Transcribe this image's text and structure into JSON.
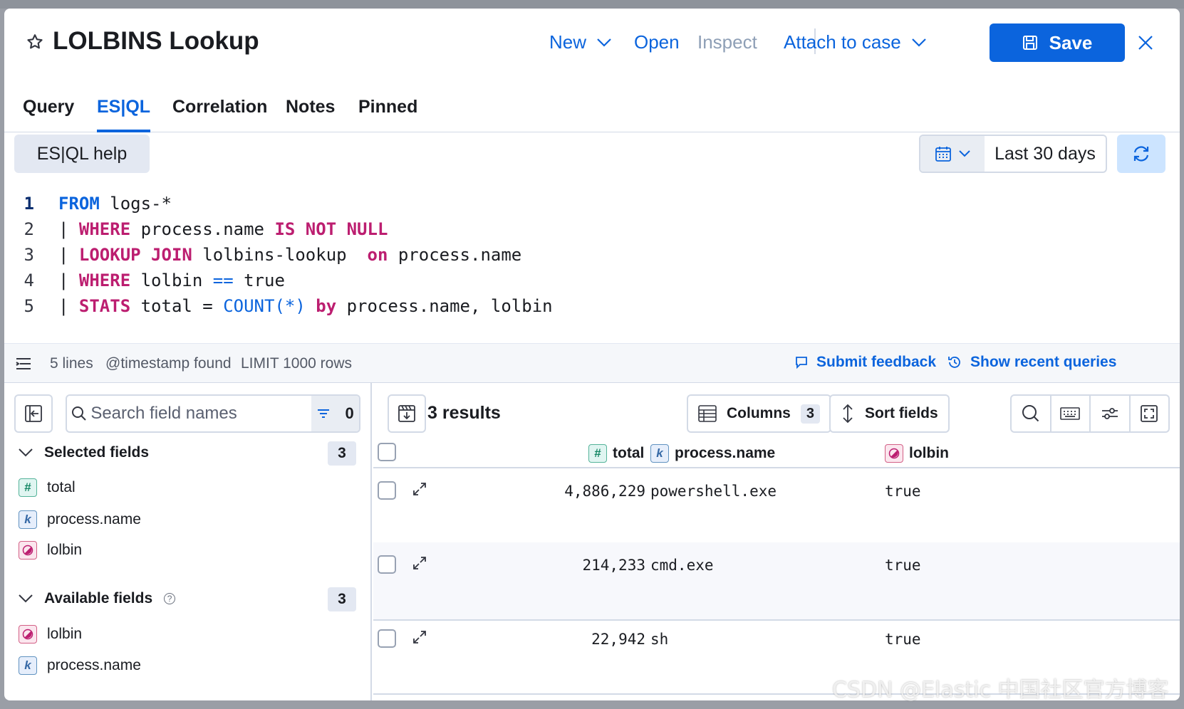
{
  "header": {
    "title": "LOLBINS Lookup",
    "new_label": "New",
    "open_label": "Open",
    "inspect_label": "Inspect",
    "attach_label": "Attach to case",
    "save_label": "Save"
  },
  "tabs": [
    {
      "label": "Query"
    },
    {
      "label": "ES|QL"
    },
    {
      "label": "Correlation"
    },
    {
      "label": "Notes"
    },
    {
      "label": "Pinned"
    }
  ],
  "editor": {
    "help_label": "ES|QL help",
    "date_range": "Last 30 days",
    "line_numbers": [
      "1",
      "2",
      "3",
      "4",
      "5"
    ]
  },
  "status": {
    "lines": "5 lines",
    "timestamp": "@timestamp found",
    "limit": "LIMIT 1000 rows",
    "feedback": "Submit feedback",
    "recent": "Show recent queries"
  },
  "sidebar": {
    "search_placeholder": "Search field names",
    "filter_count": "0",
    "selected": {
      "label": "Selected fields",
      "count": "3",
      "fields": [
        {
          "name": "total",
          "type": "number"
        },
        {
          "name": "process.name",
          "type": "keyword"
        },
        {
          "name": "lolbin",
          "type": "boolean"
        }
      ]
    },
    "available": {
      "label": "Available fields",
      "count": "3",
      "fields": [
        {
          "name": "lolbin",
          "type": "boolean"
        },
        {
          "name": "process.name",
          "type": "keyword"
        }
      ]
    }
  },
  "grid": {
    "results_label": "3 results",
    "columns_label": "Columns",
    "columns_count": "3",
    "sort_label": "Sort fields",
    "headers": [
      "total",
      "process.name",
      "lolbin"
    ],
    "rows": [
      {
        "total": "4,886,229",
        "process_name": "powershell.exe",
        "lolbin": "true"
      },
      {
        "total": "214,233",
        "process_name": "cmd.exe",
        "lolbin": "true"
      },
      {
        "total": "22,942",
        "process_name": "sh",
        "lolbin": "true"
      }
    ]
  },
  "watermark": "CSDN @Elastic 中国社区官方博客",
  "colors": {
    "accent": "#0b64dd",
    "keyword_pink": "#bc1e70"
  }
}
